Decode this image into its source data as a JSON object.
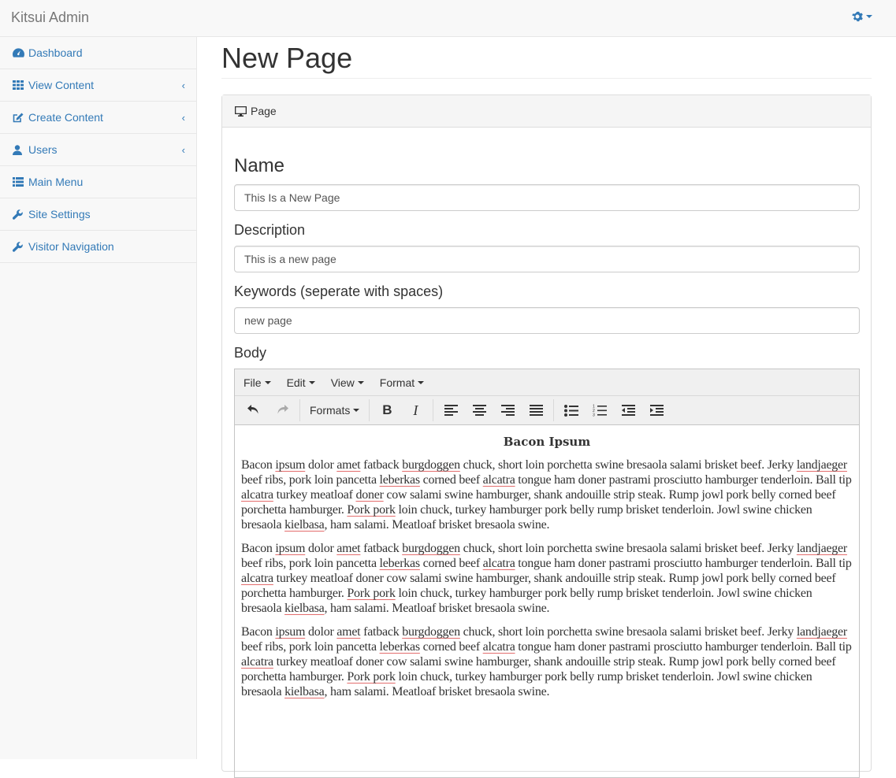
{
  "app": {
    "brand": "Kitsui Admin"
  },
  "sidebar": {
    "items": [
      {
        "label": "Dashboard",
        "icon": "dashboard-icon",
        "has_chevron": false
      },
      {
        "label": "View Content",
        "icon": "grid-icon",
        "has_chevron": true
      },
      {
        "label": "Create Content",
        "icon": "edit-icon",
        "has_chevron": true
      },
      {
        "label": "Users",
        "icon": "user-icon",
        "has_chevron": true
      },
      {
        "label": "Main Menu",
        "icon": "list-icon",
        "has_chevron": false
      },
      {
        "label": "Site Settings",
        "icon": "wrench-icon",
        "has_chevron": false
      },
      {
        "label": "Visitor Navigation",
        "icon": "wrench-icon",
        "has_chevron": false
      }
    ],
    "chevron": "‹"
  },
  "main": {
    "title": "New Page",
    "panel_heading": "Page",
    "form": {
      "name_label": "Name",
      "name_value": "This Is a New Page",
      "description_label": "Description",
      "description_value": "This is a new page",
      "keywords_label": "Keywords (seperate with spaces)",
      "keywords_value": "new page",
      "body_label": "Body"
    }
  },
  "editor": {
    "menus": [
      "File",
      "Edit",
      "View",
      "Format"
    ],
    "formats_label": "Formats",
    "heading": "Bacon Ipsum",
    "paragraph_words": {
      "w1": "Bacon",
      "w2": "ipsum",
      "w3": "dolor",
      "w4": "amet",
      "w5": "fatback",
      "w6": "burgdoggen",
      "w7": "chuck, short loin porchetta swine bresaola salami brisket beef. Jerky",
      "w8": "landjaeger",
      "w9": "beef ribs, pork loin pancetta",
      "w10": "leberkas",
      "w11": "corned beef",
      "w12": "alcatra",
      "w13": "tongue ham doner pastrami prosciutto hamburger tenderloin. Ball tip",
      "w14": "alcatra",
      "w15": "turkey meatloaf",
      "w16": "doner",
      "w17": "cow salami swine hamburger, shank andouille strip steak. Rump jowl pork belly corned beef porchetta hamburger.",
      "w18": "Pork pork",
      "w19": "loin chuck, turkey hamburger pork belly rump brisket tenderloin. Jowl swine chicken bresaola",
      "w20": "kielbasa",
      "w21": ", ham salami. Meatloaf brisket bresaola swine."
    },
    "paragraph_count": 3
  },
  "colors": {
    "link": "#337ab7",
    "spell_underline": "#e36d6d"
  }
}
